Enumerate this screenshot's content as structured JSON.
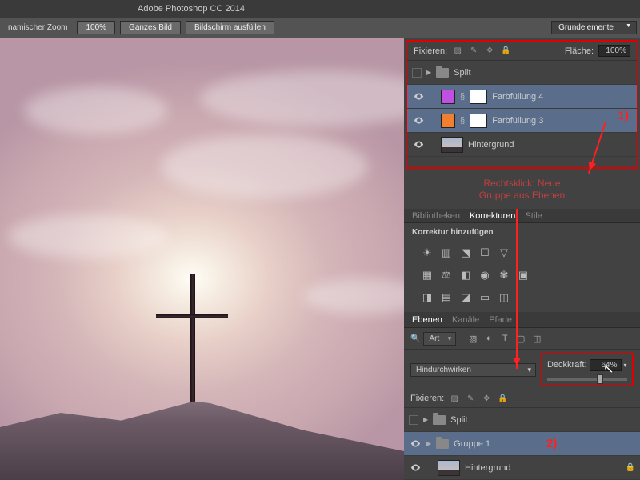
{
  "app_title": "Adobe Photoshop CC 2014",
  "toolbar": {
    "zoom_label": "namischer Zoom",
    "zoom_value": "100%",
    "fit_btn": "Ganzes Bild",
    "fill_btn": "Bildschirm ausfüllen",
    "workspace": "Grundelemente"
  },
  "panel1": {
    "lock_label": "Fixieren:",
    "fill_label": "Fläche:",
    "fill_value": "100%",
    "layers": [
      {
        "name": "Split"
      },
      {
        "name": "Farbfüllung 4"
      },
      {
        "name": "Farbfüllung 3"
      },
      {
        "name": "Hintergrund"
      }
    ]
  },
  "annotation1": "1)",
  "annotation_text": "Rechtsklick: Neue\nGruppe aus Ebenen",
  "panel2": {
    "tabs": {
      "lib": "Bibliotheken",
      "korr": "Korrekturen",
      "stile": "Stile"
    },
    "add_label": "Korrektur hinzufügen"
  },
  "panel3": {
    "tabs": {
      "eb": "Ebenen",
      "kan": "Kanäle",
      "pf": "Pfade"
    },
    "filter_label": "Art",
    "blend_mode": "Hindurchwirken",
    "opacity_label": "Deckkraft:",
    "opacity_value": "64%",
    "lock_label": "Fixieren:",
    "layers": [
      {
        "name": "Split"
      },
      {
        "name": "Gruppe 1"
      },
      {
        "name": "Hintergrund"
      }
    ]
  },
  "annotation2": "2)"
}
